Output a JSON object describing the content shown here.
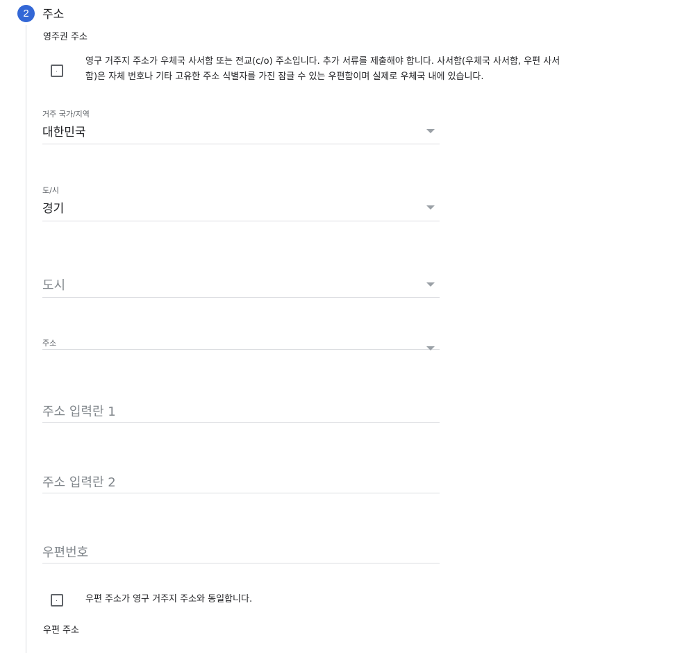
{
  "step": {
    "number": "2",
    "title": "주소"
  },
  "permanent_address": {
    "heading": "영주권 주소",
    "po_box_checkbox": {
      "checked": false,
      "line1": "영구 거주지 주소가 우체국 사서함 또는 전교(c/o) 주소입니다. 추가 서류를 제출해야 합니다. 사서함(우체국 사서함, 우편 사서",
      "line2": "함)은 자체 번호나 기타 고유한 주소 식별자를 가진 잠글 수 있는 우편함이며 실제로 우체국 내에 있습니다."
    },
    "country": {
      "label": "거주 국가/지역",
      "value": "대한민국"
    },
    "province": {
      "label": "도/시",
      "value": "경기"
    },
    "city": {
      "placeholder": "도시"
    },
    "address_select": {
      "label": "주소"
    },
    "address_line1": {
      "placeholder": "주소 입력란 1"
    },
    "address_line2": {
      "placeholder": "주소 입력란 2"
    },
    "postal_code": {
      "placeholder": "우편번호"
    }
  },
  "same_as_permanent_checkbox": {
    "checked": false,
    "label": "우편 주소가 영구 거주지 주소와 동일합니다."
  },
  "mailing_address": {
    "heading": "우편 주소"
  },
  "colors": {
    "accent": "#3367d6",
    "divider": "#dadce0",
    "placeholder": "#80868b"
  }
}
